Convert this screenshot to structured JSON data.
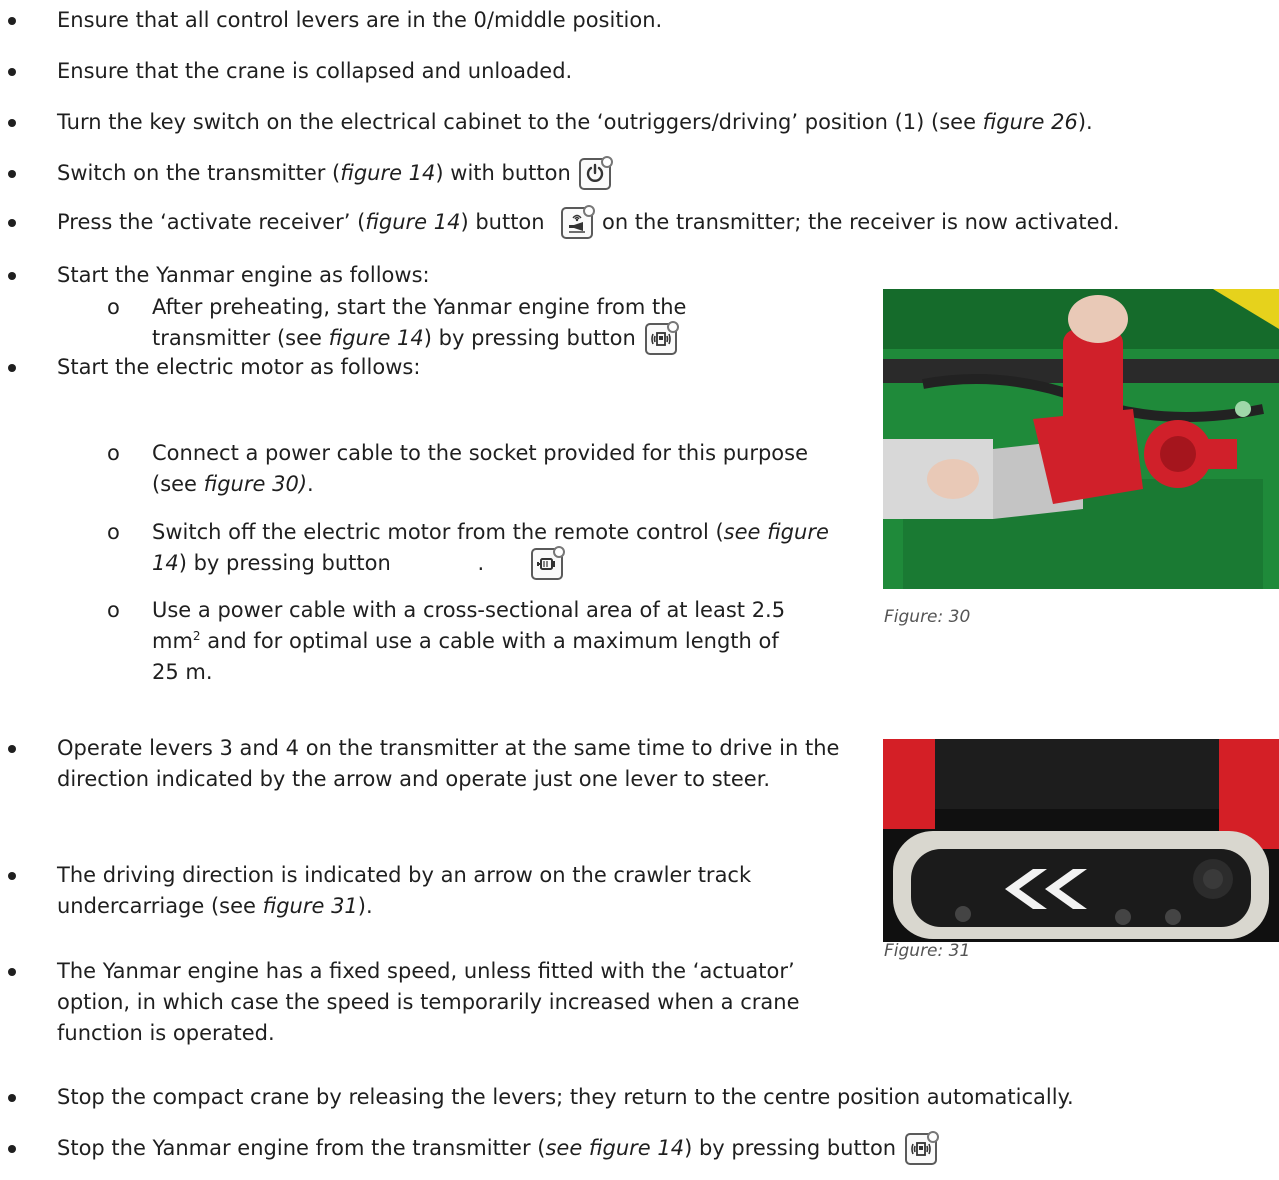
{
  "bullets": {
    "b1": "Ensure that all control levers are in the 0/middle position.",
    "b2": "Ensure that the crane is collapsed and unloaded.",
    "b3_a": "Turn the key switch on the electrical cabinet to the ‘outriggers/driving’ position (1) (see ",
    "b3_fig": "figure 26",
    "b3_b": ").",
    "b4_a": "Switch on the transmitter (",
    "b4_fig": "figure 14",
    "b4_b": ") with button",
    "b5_a": "Press the ‘activate receiver’ (",
    "b5_fig": "figure 14",
    "b5_b": ") button",
    "b5_c": "on the transmitter; the receiver is now activated.",
    "b6": "Start the Yanmar engine as follows:",
    "b6_s1_a": "After preheating, start the Yanmar engine from the transmitter (see ",
    "b6_s1_fig": "figure 14",
    "b6_s1_b": ") by pressing button",
    "b7": "Start the electric motor as follows:",
    "b7_s1_a": "Connect a power cable to the socket provided for this purpose (see ",
    "b7_s1_fig": "figure 30)",
    "b7_s1_b": ".",
    "b7_s2_a": "Switch off the electric motor from the remote control (",
    "b7_s2_fig": "see figure 14",
    "b7_s2_b": ") by pressing button",
    "b7_s2_c": ".",
    "b7_s3_a": "Use a power cable with a cross-sectional area of at least 2.5 mm",
    "b7_s3_sup": "2",
    "b7_s3_b": " and for optimal use a cable with a maximum length of 25 m.",
    "b8": "Operate levers 3 and 4 on the transmitter at the same time to drive in the direction indicated by the arrow and operate just one lever to steer.",
    "b9_a": "The driving direction is indicated by an arrow on the crawler track undercarriage (see ",
    "b9_fig": "figure 31",
    "b9_b": ").",
    "b10": "The Yanmar engine has a fixed speed, unless fitted with the ‘actuator’ option, in which case the speed is temporarily increased when a crane function is operated.",
    "b11": "Stop the compact crane by releasing the levers; they return to the centre position automatically.",
    "b12_a": "Stop the Yanmar engine from the transmitter (",
    "b12_fig": "see figure 14",
    "b12_b": ") by pressing button"
  },
  "figures": {
    "fig30_caption": "Figure: 30",
    "fig31_caption": "Figure: 31"
  },
  "icons": {
    "power": "power-icon",
    "receiver": "activate-receiver-icon",
    "engine": "engine-start-icon",
    "motor": "electric-motor-icon"
  },
  "colors": {
    "text": "#1f1f1f",
    "machine_green": "#1f8a3a",
    "connector_red": "#d0202a",
    "track_red": "#d41f26"
  }
}
